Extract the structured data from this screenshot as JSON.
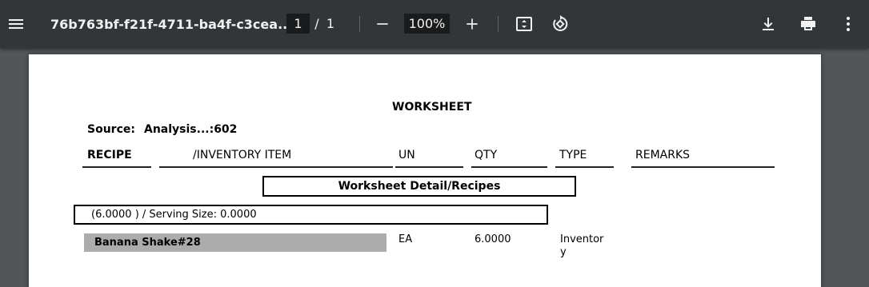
{
  "toolbar": {
    "title": "76b763bf-f21f-4711-ba4f-c3cea...",
    "page_current": "1",
    "page_separator": "/",
    "page_total": "1",
    "zoom": "100%",
    "icons": [
      "menu-icon",
      "zoom-out-icon",
      "zoom-in-icon",
      "fit-page-icon",
      "rotate-icon",
      "download-icon",
      "print-icon",
      "more-vert-icon"
    ]
  },
  "document": {
    "heading": "WORKSHEET",
    "source_label": "Source:",
    "source_value": "Analysis...:602",
    "columns": {
      "recipe": "RECIPE",
      "inventory_item": "/INVENTORY ITEM",
      "un": "UN",
      "qty": "QTY",
      "type": "TYPE",
      "remarks": "REMARKS"
    },
    "section_title": "Worksheet Detail/Recipes",
    "serving_line": "(6.0000 ) / Serving Size: 0.0000",
    "rows": [
      {
        "name": "Banana Shake#28",
        "un": "EA",
        "qty": "6.0000",
        "type_line1": "Inventor",
        "type_line2": "y"
      }
    ]
  },
  "colors": {
    "toolbar_bg": "#323639",
    "viewer_bg": "#525659",
    "page_bg": "#ffffff",
    "row_highlight": "#acacac"
  }
}
